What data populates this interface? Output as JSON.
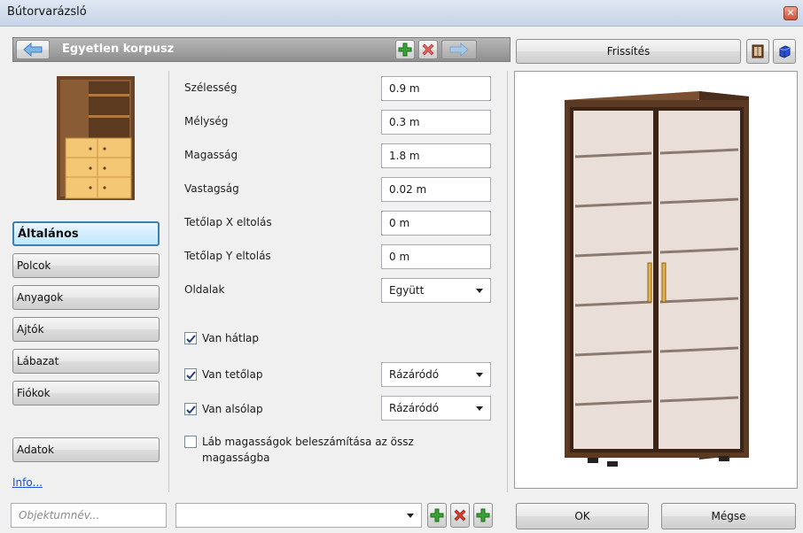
{
  "window": {
    "title": "Bútorvarázsló",
    "close_glyph": "✕"
  },
  "nav": {
    "title": "Egyetlen korpusz",
    "back_icon": "arrow-left-icon",
    "forward_icon": "arrow-right-icon",
    "add_icon": "plus-icon",
    "delete_icon": "x-icon"
  },
  "preview": {
    "refresh_label": "Frissítés",
    "view_icons": [
      "cabinet-icon",
      "cube-icon"
    ]
  },
  "categories": {
    "items": [
      {
        "label": "Általános",
        "active": true
      },
      {
        "label": "Polcok"
      },
      {
        "label": "Anyagok"
      },
      {
        "label": "Ajtók"
      },
      {
        "label": "Lábazat"
      },
      {
        "label": "Fiókok"
      }
    ],
    "data_label": "Adatok",
    "info_link": "Info..."
  },
  "properties": [
    {
      "label": "Szélesség",
      "value": "0.9 m"
    },
    {
      "label": "Mélység",
      "value": "0.3 m"
    },
    {
      "label": "Magasság",
      "value": "1.8 m"
    },
    {
      "label": "Vastagság",
      "value": "0.02 m"
    },
    {
      "label": "Tetőlap X eltolás",
      "value": "0 m"
    },
    {
      "label": "Tetőlap Y eltolás",
      "value": "0 m"
    }
  ],
  "sides": {
    "label": "Oldalak",
    "value": "Együtt"
  },
  "checks": {
    "back": {
      "label": "Van hátlap",
      "checked": true
    },
    "top": {
      "label": "Van tetőlap",
      "checked": true,
      "value": "Rázáródó"
    },
    "bottom": {
      "label": "Van alsólap",
      "checked": true,
      "value": "Rázáródó"
    },
    "legs": {
      "label_line1": "Láb magasságok beleszámítása az össz",
      "label_line2": "magasságba",
      "checked": false
    }
  },
  "bottom": {
    "object_name_placeholder": "Objektumnév...",
    "ok_label": "OK",
    "cancel_label": "Mégse"
  },
  "colors": {
    "accent": "#3c7fb1",
    "wood_dark": "#5a3a22",
    "wood_light": "#f3c77a"
  }
}
